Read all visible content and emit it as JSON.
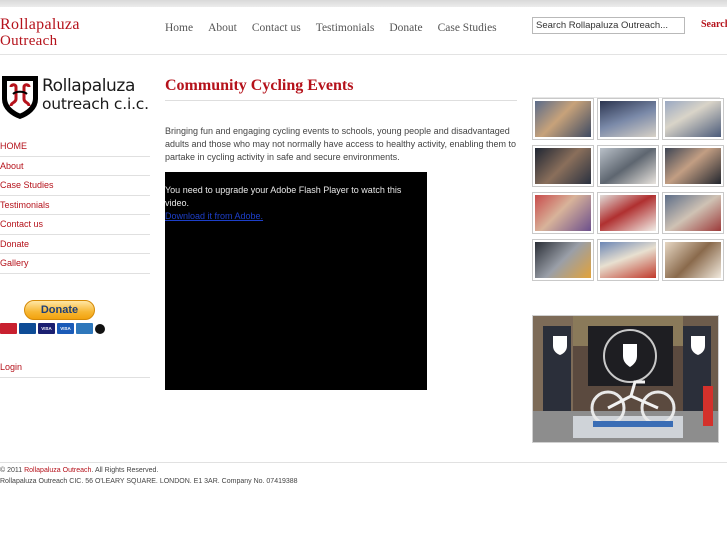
{
  "site": {
    "title_line1": "Rollapaluza",
    "title_line2": "Outreach"
  },
  "nav": {
    "home": "Home",
    "about": "About",
    "contact": "Contact us",
    "testimonials": "Testimonials",
    "donate": "Donate",
    "case_studies": "Case Studies"
  },
  "search": {
    "value": "Search Rollapaluza Outreach...",
    "button_label": "Search"
  },
  "logo": {
    "name": "Rollapaluza",
    "subtitle": "outreach c.i.c."
  },
  "sidebar": {
    "items": [
      {
        "label": "HOME"
      },
      {
        "label": "About"
      },
      {
        "label": "Case Studies"
      },
      {
        "label": "Testimonials"
      },
      {
        "label": "Contact us"
      },
      {
        "label": "Donate"
      },
      {
        "label": "Gallery"
      }
    ],
    "donate_button": "Donate",
    "cards": [
      "VISA",
      "VISA"
    ],
    "login": "Login"
  },
  "main": {
    "title": "Community Cycling Events",
    "intro": "Bringing fun and engaging cycling events to schools, young people and disadvantaged adults and those who may not normally have access to healthy activity, enabling them to partake in cycling activity in safe and secure environments.",
    "flash_message": "You need to upgrade your Adobe Flash Player to watch this video.",
    "flash_link": "Download it from Adobe."
  },
  "footer": {
    "copyright_prefix": "© 2011",
    "copyright_link": "Rollapaluza Outreach",
    "copyright_suffix": ". All Rights Reserved.",
    "address": "Rollapaluza Outreach CIC. 56 O'LEARY SQUARE. LONDON. E1 3AR. Company No. 07419388"
  },
  "colors": {
    "brand_red": "#b5121b",
    "link_blue": "#1d3fc9"
  }
}
